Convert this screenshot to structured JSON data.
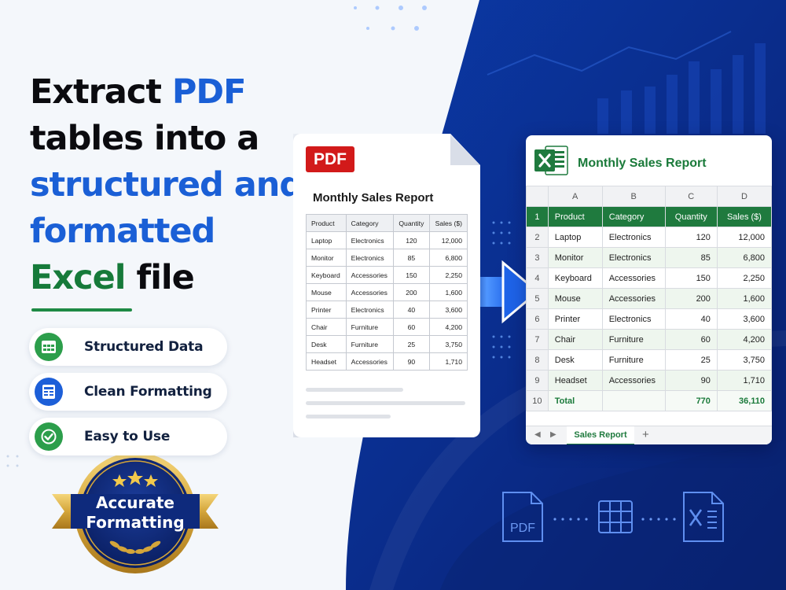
{
  "headline": {
    "line1_a": "Extract ",
    "line1_b": "PDF",
    "line2": "tables into a",
    "line3": "structured and",
    "line4": "formatted",
    "line5_a": "Excel",
    "line5_b": " file"
  },
  "features": [
    {
      "label": "Structured Data",
      "icon": "spreadsheet-icon",
      "color": "#2c9e4b"
    },
    {
      "label": "Clean Formatting",
      "icon": "table-icon",
      "color": "#1d5fd8"
    },
    {
      "label": "Easy to Use",
      "icon": "check-icon",
      "color": "#2c9e4b"
    }
  ],
  "badge": {
    "line1": "Accurate",
    "line2": "Formatting"
  },
  "pdf": {
    "badge": "PDF",
    "title": "Monthly Sales Report",
    "headers": [
      "Product",
      "Category",
      "Quantity",
      "Sales ($)"
    ],
    "rows": [
      [
        "Laptop",
        "Electronics",
        "120",
        "12,000"
      ],
      [
        "Monitor",
        "Electronics",
        "85",
        "6,800"
      ],
      [
        "Keyboard",
        "Accessories",
        "150",
        "2,250"
      ],
      [
        "Mouse",
        "Accessories",
        "200",
        "1,600"
      ],
      [
        "Printer",
        "Electronics",
        "40",
        "3,600"
      ],
      [
        "Chair",
        "Furniture",
        "60",
        "4,200"
      ],
      [
        "Desk",
        "Furniture",
        "25",
        "3,750"
      ],
      [
        "Headset",
        "Accessories",
        "90",
        "1,710"
      ]
    ]
  },
  "excel": {
    "title": "Monthly Sales Report",
    "columns": [
      "A",
      "B",
      "C",
      "D"
    ],
    "headers": [
      "Product",
      "Category",
      "Quantity",
      "Sales ($)"
    ],
    "rows": [
      [
        "Laptop",
        "Electronics",
        "120",
        "12,000"
      ],
      [
        "Monitor",
        "Electronics",
        "85",
        "6,800"
      ],
      [
        "Keyboard",
        "Accessories",
        "150",
        "2,250"
      ],
      [
        "Mouse",
        "Accessories",
        "200",
        "1,600"
      ],
      [
        "Printer",
        "Electronics",
        "40",
        "3,600"
      ],
      [
        "Chair",
        "Furniture",
        "60",
        "4,200"
      ],
      [
        "Desk",
        "Furniture",
        "25",
        "3,750"
      ],
      [
        "Headset",
        "Accessories",
        "90",
        "1,710"
      ]
    ],
    "total": [
      "Total",
      "",
      "770",
      "36,110"
    ],
    "sheet_tab": "Sales Report",
    "add_sheet": "+"
  },
  "flow": {
    "pdf_label": "PDF"
  },
  "colors": {
    "navy": "#0a2a86",
    "brand_blue": "#1a5fd6",
    "excel_green": "#1f7a3e",
    "pdf_red": "#d21a1a",
    "gold": "#d4a53a"
  }
}
